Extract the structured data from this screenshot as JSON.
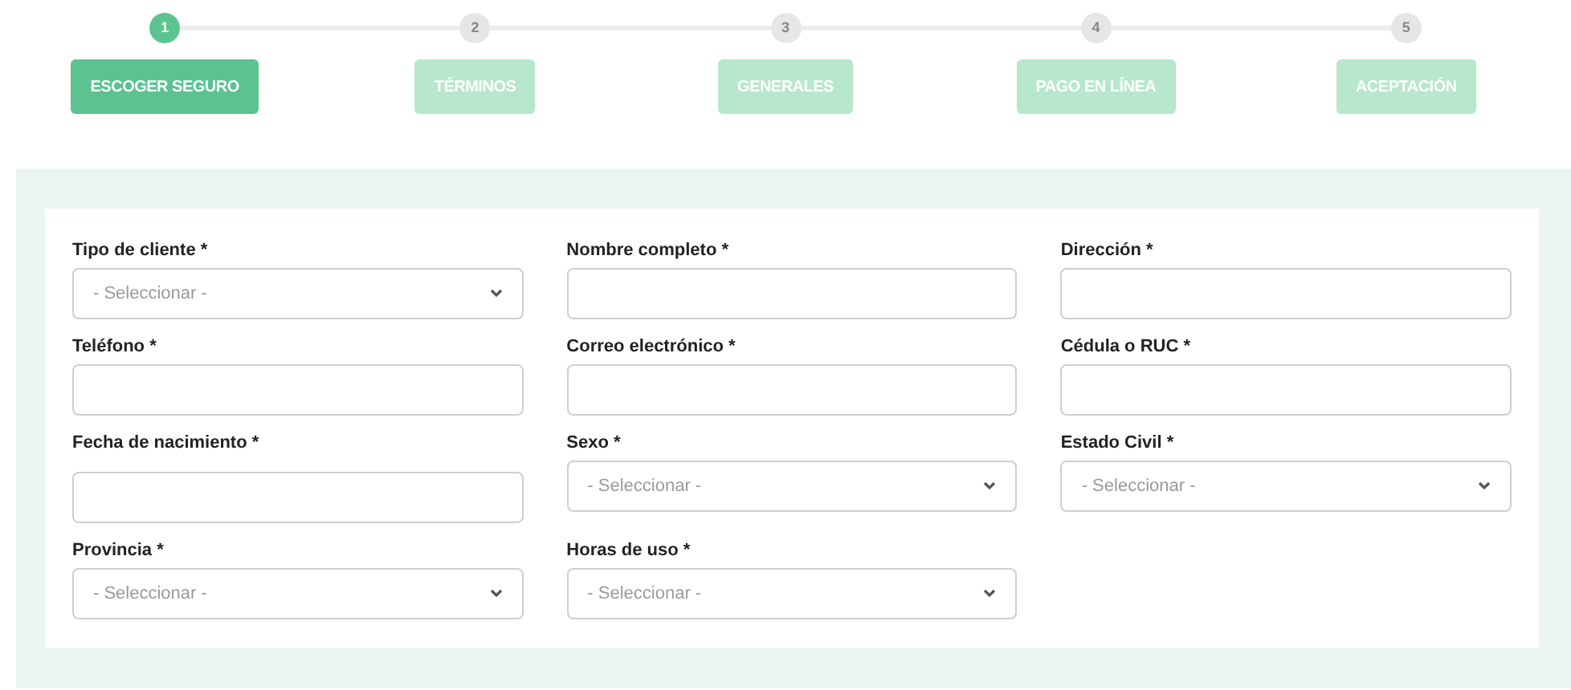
{
  "steps": [
    {
      "number": "1",
      "label": "ESCOGER SEGURO",
      "selected": true
    },
    {
      "number": "2",
      "label": "TÉRMINOS",
      "selected": false
    },
    {
      "number": "3",
      "label": "GENERALES",
      "selected": false
    },
    {
      "number": "4",
      "label": "PAGO EN LÍNEA",
      "selected": false
    },
    {
      "number": "5",
      "label": "ACEPTACIÓN",
      "selected": false
    }
  ],
  "form": {
    "rows": [
      [
        {
          "kind": "select",
          "label": "Tipo de cliente *",
          "placeholder": "- Seleccionar -"
        },
        {
          "kind": "input",
          "label": "Nombre completo *"
        },
        {
          "kind": "input",
          "label": "Dirección *"
        }
      ],
      [
        {
          "kind": "input",
          "label": "Teléfono *"
        },
        {
          "kind": "input",
          "label": "Correo electrónico *"
        },
        {
          "kind": "input",
          "label": "Cédula o RUC *"
        }
      ],
      [
        {
          "kind": "input",
          "label": "Fecha de nacimiento *"
        },
        {
          "kind": "select",
          "label": "Sexo *",
          "placeholder": "- Seleccionar -"
        },
        {
          "kind": "select",
          "label": "Estado Civil *",
          "placeholder": "- Seleccionar -"
        }
      ],
      [
        {
          "kind": "select",
          "label": "Provincia *",
          "placeholder": "- Seleccionar -"
        },
        {
          "kind": "select",
          "label": "Horas de uso *",
          "placeholder": "- Seleccionar -"
        }
      ]
    ]
  }
}
